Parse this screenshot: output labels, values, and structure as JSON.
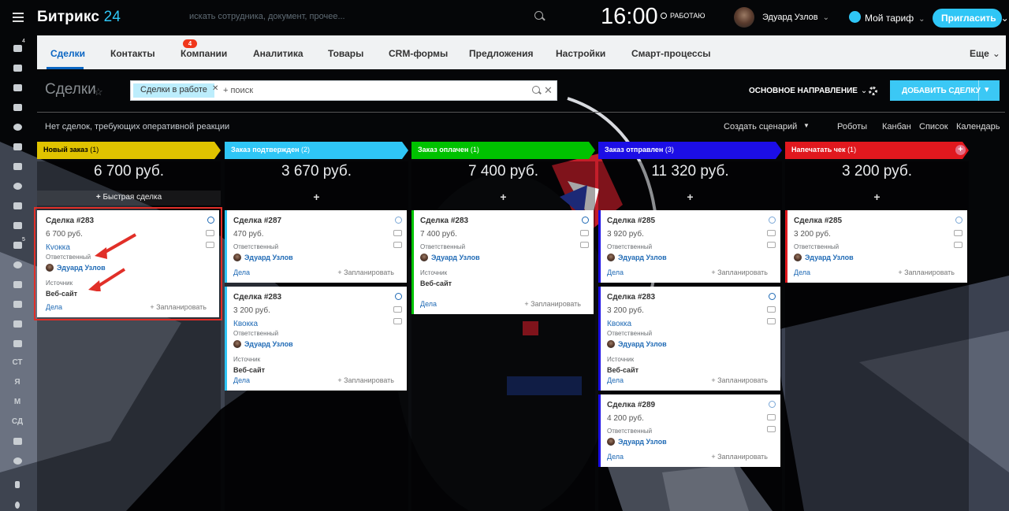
{
  "app": {
    "logo_main": "Битрикс",
    "logo_num": "24",
    "search_placeholder": "искать сотрудника, документ, прочее...",
    "clock": "16:00",
    "work_status": "РАБОТАЮ",
    "user_name": "Эдуард Узлов",
    "tarif": "Мой тариф",
    "invite": "Пригласить"
  },
  "sidebar": {
    "badge_1": "4",
    "badge_2": "5",
    "text_items": [
      "СТ",
      "Я",
      "М",
      "СД"
    ]
  },
  "tabs": {
    "items": [
      "Сделки",
      "Контакты",
      "Компании",
      "Аналитика",
      "Товары",
      "CRM-формы",
      "Предложения",
      "Настройки",
      "Смарт-процессы"
    ],
    "contacts_badge": "4",
    "more": "Еще"
  },
  "page": {
    "title": "Сделки",
    "filter_chip": "Сделки в работе",
    "filter_placeholder": "+ поиск",
    "direction": "ОСНОВНОЕ НАПРАВЛЕНИЕ",
    "add_deal": "ДОБАВИТЬ СДЕЛКУ",
    "no_reaction": "Нет сделок, требующих оперативной реакции",
    "create_scenario": "Создать сценарий",
    "robots": "Роботы",
    "views": [
      "Канбан",
      "Список",
      "Календарь"
    ]
  },
  "columns": [
    {
      "title": "Новый заказ",
      "count": "(1)",
      "color": "#e0c300",
      "sum": "6 700 руб.",
      "quick": "Быстрая сделка",
      "cards": [
        {
          "title": "Сделка #283",
          "sum": "6 700 руб.",
          "company": "Кvокка",
          "resp_label": "Ответственный",
          "person": "Эдуард Узлов",
          "source_label": "Источник",
          "source": "Веб-сайт",
          "dela": "Дела",
          "plan": "+ Запланировать"
        }
      ]
    },
    {
      "title": "Заказ подтвержден",
      "count": "(2)",
      "color": "#2fc6f6",
      "sum": "3 670 руб.",
      "cards": [
        {
          "title": "Сделка #287",
          "sum": "470 руб.",
          "resp_label": "Ответственный",
          "person": "Эдуард Узлов",
          "dela": "Дела",
          "plan": "+ Запланировать"
        },
        {
          "title": "Сделка #283",
          "sum": "3 200 руб.",
          "company": "Квокка",
          "resp_label": "Ответственный",
          "person": "Эдуард Узлов",
          "source_label": "Источник",
          "source": "Веб-сайт",
          "dela": "Дела",
          "plan": "+ Запланировать"
        }
      ]
    },
    {
      "title": "Заказ оплачен",
      "count": "(1)",
      "color": "#00c200",
      "sum": "7 400 руб.",
      "cards": [
        {
          "title": "Сделка #283",
          "sum": "7 400 руб.",
          "resp_label": "Ответственный",
          "person": "Эдуард Узлов",
          "source_label": "Источник",
          "source": "Веб-сайт",
          "dela": "Дела",
          "plan": "+ Запланировать"
        }
      ]
    },
    {
      "title": "Заказ отправлен",
      "count": "(3)",
      "color": "#1c0ee6",
      "sum": "11 320 руб.",
      "cards": [
        {
          "title": "Сделка #285",
          "sum": "3 920 руб.",
          "resp_label": "Ответственный",
          "person": "Эдуард Узлов",
          "dela": "Дела",
          "plan": "+ Запланировать"
        },
        {
          "title": "Сделка #283",
          "sum": "3 200 руб.",
          "company": "Квокка",
          "resp_label": "Ответственный",
          "person": "Эдуард Узлов",
          "source_label": "Источник",
          "source": "Веб-сайт",
          "dela": "Дела",
          "plan": "+ Запланировать"
        },
        {
          "title": "Сделка #289",
          "sum": "4 200 руб.",
          "resp_label": "Ответственный",
          "person": "Эдуард Узлов",
          "dela": "Дела",
          "plan": "+ Запланировать"
        }
      ]
    },
    {
      "title": "Напечатать чек",
      "count": "(1)",
      "color": "#e1181e",
      "sum": "3 200 руб.",
      "cards": [
        {
          "title": "Сделка #285",
          "sum": "3 200 руб.",
          "resp_label": "Ответственный",
          "person": "Эдуард Узлов",
          "dela": "Дела",
          "plan": "+ Запланировать"
        }
      ]
    }
  ],
  "colors": {
    "accent": "#2fc6f6",
    "tab_active": "#0b66c3",
    "highlight": "#e12f28"
  }
}
